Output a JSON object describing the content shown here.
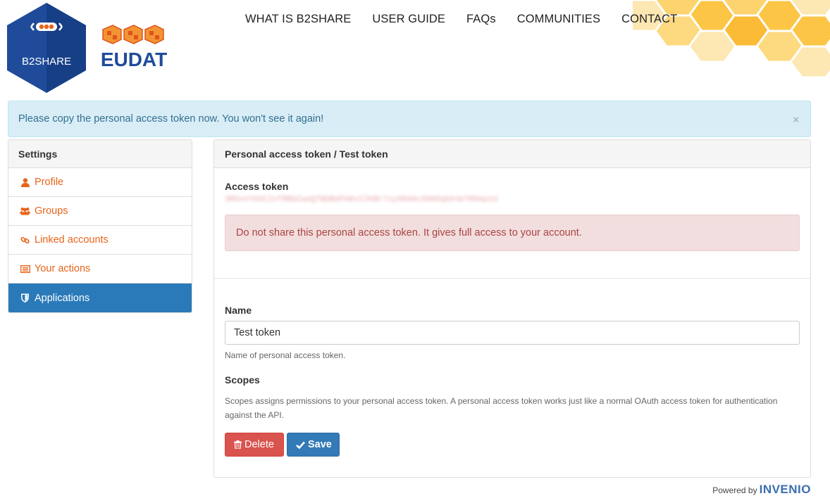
{
  "branding": {
    "product_name": "B2SHARE",
    "org_name": "EUDAT",
    "powered_by_label": "Powered by",
    "powered_by_brand": "INVENIO"
  },
  "nav": {
    "items": [
      {
        "label": "WHAT IS B2SHARE"
      },
      {
        "label": "USER GUIDE"
      },
      {
        "label": "FAQs"
      },
      {
        "label": "COMMUNITIES"
      },
      {
        "label": "CONTACT"
      }
    ]
  },
  "notice": {
    "text": "Please copy the personal access token now. You won't see it again!",
    "close_glyph": "×"
  },
  "sidebar": {
    "heading": "Settings",
    "items": [
      {
        "label": "Profile",
        "icon": "user-icon"
      },
      {
        "label": "Groups",
        "icon": "users-icon"
      },
      {
        "label": "Linked accounts",
        "icon": "link-icon"
      },
      {
        "label": "Your actions",
        "icon": "list-icon"
      },
      {
        "label": "Applications",
        "icon": "shield-icon",
        "active": true
      }
    ]
  },
  "panel": {
    "heading": "Personal access token / Test token",
    "access_token_label": "Access token",
    "access_token_value": "3RGvnYGXCIsTRBbCwoQTBDBdFHAvIIKBr7zyXK6HcSGKDqbX4eTRHep1U",
    "warning_text": "Do not share this personal access token. It gives full access to your account.",
    "name_label": "Name",
    "name_value": "Test token",
    "name_help": "Name of personal access token.",
    "scopes_label": "Scopes",
    "scopes_help": "Scopes assigns permissions to your personal access token. A personal access token works just like a normal OAuth access token for authentication against the API.",
    "delete_label": "Delete",
    "save_label": "Save"
  },
  "colors": {
    "accent_orange": "#e8641b",
    "active_blue": "#2a7ab9",
    "info_bg": "#d9edf7",
    "danger_bg": "#f2dede",
    "delete_red": "#d9534f",
    "save_blue": "#337ab7",
    "honeycomb": "#fdc94f"
  }
}
